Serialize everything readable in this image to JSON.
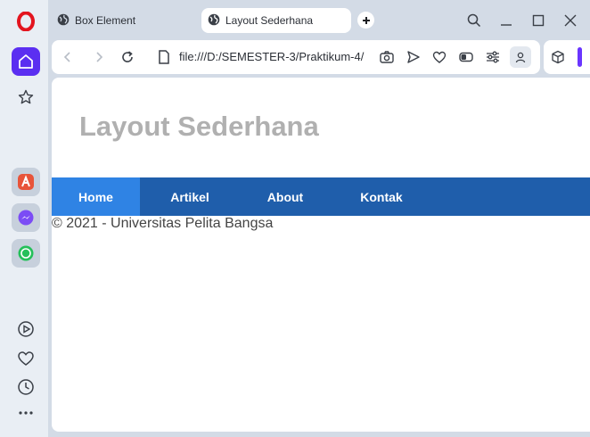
{
  "browser": {
    "tabs": [
      {
        "title": "Box Element",
        "active": false
      },
      {
        "title": "Layout Sederhana",
        "active": true
      }
    ],
    "url": "file:///D:/SEMESTER-3/Praktikum-4/",
    "sidebar_icons": [
      "opera-logo-icon",
      "home-icon",
      "star-icon",
      "aria-icon",
      "messenger-icon",
      "whatsapp-icon",
      "player-icon",
      "heart-icon",
      "history-icon",
      "more-icon"
    ],
    "accent_color": "#5b2ff1"
  },
  "page": {
    "title": "Layout Sederhana",
    "nav": {
      "items": [
        {
          "label": "Home",
          "active": true
        },
        {
          "label": "Artikel",
          "active": false
        },
        {
          "label": "About",
          "active": false
        },
        {
          "label": "Kontak",
          "active": false
        }
      ],
      "background": "#1f5eab",
      "active_background": "#2f83e4"
    },
    "footer": "© 2021 - Universitas Pelita Bangsa"
  }
}
